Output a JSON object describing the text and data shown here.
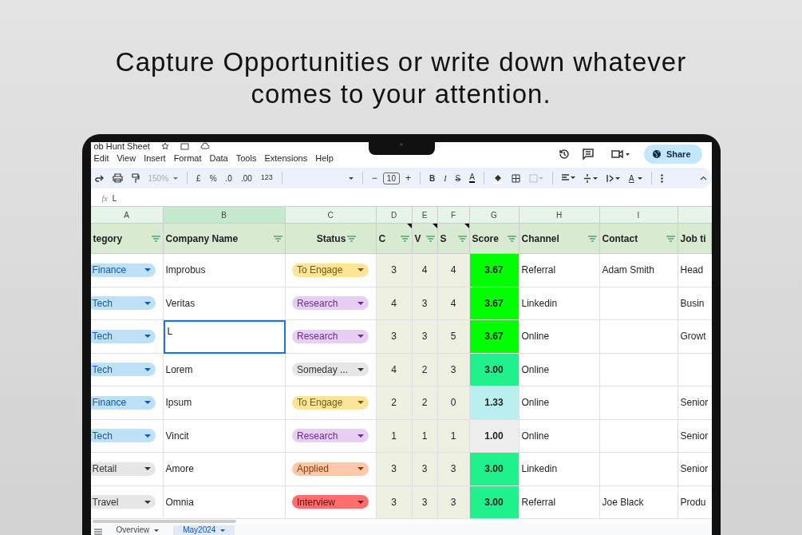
{
  "headline": "Capture Opportunities or write down whatever comes to your attention.",
  "doc_title": "ob Hunt Sheet",
  "menu": [
    "Edit",
    "View",
    "Insert",
    "Format",
    "Data",
    "Tools",
    "Extensions",
    "Help"
  ],
  "share_button": "Share",
  "toolbar": {
    "zoom": "150%",
    "currency": "£",
    "percent": "%",
    "decrease_decimals": ".0",
    "increase_decimals": ".00",
    "number_format": "123",
    "minus": "−",
    "font_size": "10",
    "plus": "+",
    "bold": "B",
    "italic": "I",
    "strike": "S",
    "text_color": "A",
    "rotate": "A"
  },
  "formula_bar": {
    "fx": "fx",
    "value": "L"
  },
  "column_letters": [
    {
      "label": "A",
      "selected": false
    },
    {
      "label": "B",
      "selected": true
    },
    {
      "label": "C",
      "selected": false
    },
    {
      "label": "D",
      "selected": false
    },
    {
      "label": "E",
      "selected": false
    },
    {
      "label": "F",
      "selected": false
    },
    {
      "label": "G",
      "selected": false
    },
    {
      "label": "H",
      "selected": false
    },
    {
      "label": "I",
      "selected": false
    }
  ],
  "headers": [
    {
      "label": "tegory",
      "note": false
    },
    {
      "label": "Company Name",
      "note": false
    },
    {
      "label": "Status",
      "note": false
    },
    {
      "label": "C",
      "note": true
    },
    {
      "label": "V",
      "note": true
    },
    {
      "label": "S",
      "note": true
    },
    {
      "label": "Score",
      "note": false
    },
    {
      "label": "Channel",
      "note": false
    },
    {
      "label": "Contact",
      "note": false
    },
    {
      "label": "Job ti",
      "note": false
    }
  ],
  "rows": [
    {
      "category": {
        "text": "Finance",
        "color": "#bfe1f6"
      },
      "company": {
        "text": "Improbus",
        "selected": false
      },
      "status": {
        "text": "To Engage",
        "color": "#fde49b"
      },
      "c": "3",
      "v": "4",
      "s": "4",
      "score": {
        "text": "3.67",
        "color": "#00ff00"
      },
      "channel": "Referral",
      "contact": "Adam Smith",
      "job_title": "Head"
    },
    {
      "category": {
        "text": "Tech",
        "color": "#bfe1f6"
      },
      "company": {
        "text": "Veritas",
        "selected": false
      },
      "status": {
        "text": "Research",
        "color": "#e6cff2"
      },
      "c": "4",
      "v": "3",
      "s": "4",
      "score": {
        "text": "3.67",
        "color": "#00ff00"
      },
      "channel": "Linkedin",
      "job_title": "Busin"
    },
    {
      "category": {
        "text": "Tech",
        "color": "#bfe1f6"
      },
      "company": {
        "text": "L",
        "selected": true
      },
      "status": {
        "text": "Research",
        "color": "#e6cff2"
      },
      "c": "3",
      "v": "3",
      "s": "5",
      "score": {
        "text": "3.67",
        "color": "#00ff00"
      },
      "channel": "Online",
      "job_title": "Growt"
    },
    {
      "category": {
        "text": "Tech",
        "color": "#bfe1f6"
      },
      "company": {
        "text": "Lorem",
        "selected": false
      },
      "status": {
        "text": "Someday ...",
        "color": "#e6e6e6"
      },
      "c": "4",
      "v": "2",
      "s": "3",
      "score": {
        "text": "3.00",
        "color": "#1ff28d"
      },
      "channel": "Online"
    },
    {
      "category": {
        "text": "Finance",
        "color": "#bfe1f6"
      },
      "company": {
        "text": "Ipsum",
        "selected": false
      },
      "status": {
        "text": "To Engage",
        "color": "#fde49b"
      },
      "c": "2",
      "v": "2",
      "s": "0",
      "score": {
        "text": "1.33",
        "color": "#b9f0ef"
      },
      "channel": "Online",
      "job_title": "Senior"
    },
    {
      "category": {
        "text": "Tech",
        "color": "#bfe1f6"
      },
      "company": {
        "text": "Vincit",
        "selected": false
      },
      "status": {
        "text": "Research",
        "color": "#e6cff2"
      },
      "c": "1",
      "v": "1",
      "s": "1",
      "score": {
        "text": "1.00",
        "color": "#eeeeee"
      },
      "channel": "Online",
      "job_title": "Senior"
    },
    {
      "category": {
        "text": "Retail",
        "color": "#e6e6e6"
      },
      "company": {
        "text": "Amore",
        "selected": false
      },
      "status": {
        "text": "Applied",
        "color": "#ffc8aa"
      },
      "c": "3",
      "v": "3",
      "s": "3",
      "score": {
        "text": "3.00",
        "color": "#1ff28d"
      },
      "channel": "Linkedin",
      "job_title": "Senior"
    },
    {
      "category": {
        "text": "Travel",
        "color": "#e6e6e6"
      },
      "company": {
        "text": "Omnia",
        "selected": false
      },
      "status": {
        "text": "Interview",
        "color": "#ff6d6d"
      },
      "c": "3",
      "v": "3",
      "s": "3",
      "score": {
        "text": "3.00",
        "color": "#1ff28d"
      },
      "channel": "Referral",
      "contact": "Joe Black",
      "job_title": "Produ"
    }
  ],
  "sheet_tabs": [
    {
      "label": "Overview",
      "selected": false
    },
    {
      "label": "May2024",
      "selected": true
    }
  ]
}
